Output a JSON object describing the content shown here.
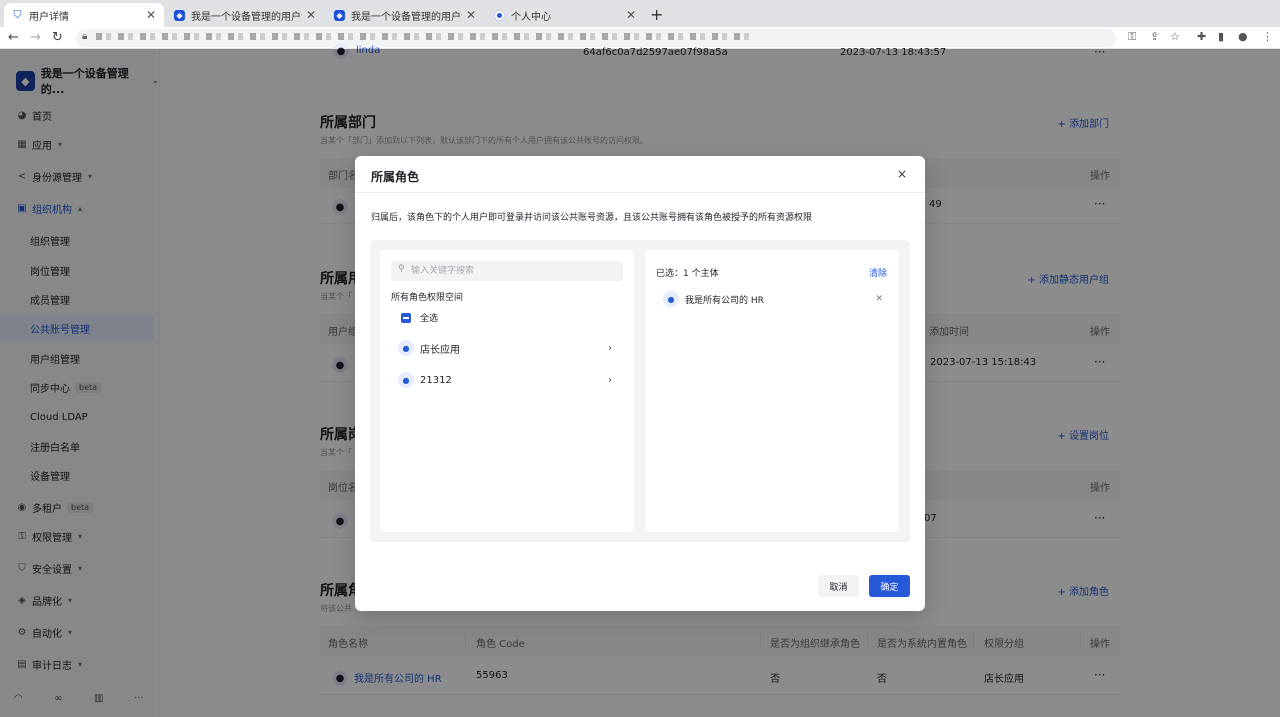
{
  "browser": {
    "tabs": [
      {
        "title": "用户详情",
        "active": true
      },
      {
        "title": "我是一个设备管理的用户池",
        "active": false
      },
      {
        "title": "我是一个设备管理的用户池",
        "active": false
      },
      {
        "title": "个人中心",
        "active": false
      }
    ]
  },
  "sidebar": {
    "brand": "我是一个设备管理的...",
    "items": [
      {
        "label": "首页"
      },
      {
        "label": "应用"
      },
      {
        "label": "身份源管理"
      },
      {
        "label": "组织机构"
      },
      {
        "label": "组织管理"
      },
      {
        "label": "岗位管理"
      },
      {
        "label": "成员管理"
      },
      {
        "label": "公共账号管理"
      },
      {
        "label": "用户组管理"
      },
      {
        "label": "同步中心",
        "badge": "beta"
      },
      {
        "label": "Cloud LDAP"
      },
      {
        "label": "注册白名单"
      },
      {
        "label": "设备管理"
      },
      {
        "label": "多租户",
        "badge": "beta"
      },
      {
        "label": "权限管理"
      },
      {
        "label": "安全设置"
      },
      {
        "label": "品牌化"
      },
      {
        "label": "自动化"
      },
      {
        "label": "审计日志"
      }
    ]
  },
  "main": {
    "top_row": {
      "name": "linda",
      "id": "64af6c0a7d2597ae07f98a5a",
      "time": "2023-07-13 18:43:57"
    },
    "departments": {
      "title": "所属部门",
      "desc": "当某个「部门」添加到以下列表，默认该部门下的所有个人用户拥有该公共账号的访问权限。",
      "action": "+ 添加部门",
      "col_first": "部门名",
      "col_ops": "操作",
      "row_tail": "49"
    },
    "groups": {
      "title": "所属用",
      "desc": "当某个「",
      "action": "+ 添加静态用户组",
      "col_first": "用户组",
      "col_time": "添加时间",
      "col_ops": "操作",
      "row_time": "2023-07-13 15:18:43"
    },
    "posts": {
      "title": "所属岗",
      "desc": "当某个「",
      "action": "+ 设置岗位",
      "col_first": "岗位名",
      "col_ops": "操作",
      "row_tail": "07"
    },
    "roles": {
      "title": "所属角",
      "desc": "将该公共",
      "action": "+ 添加角色",
      "columns": [
        "角色名称",
        "角色 Code",
        "是否为组织继承角色",
        "是否为系统内置角色",
        "权限分组",
        "操作"
      ],
      "row": {
        "name": "我是所有公司的 HR",
        "code": "55963",
        "inherit": "否",
        "builtin": "否",
        "group": "店长应用"
      }
    },
    "more": "···"
  },
  "modal": {
    "title": "所属角色",
    "desc": "归属后，该角色下的个人用户即可登录并访问该公共账号资源，且该公共账号拥有该角色被授予的所有资源权限",
    "search_placeholder": "输入关键字搜索",
    "space_label": "所有角色权限空间",
    "check_all": "全选",
    "apps": [
      {
        "label": "店长应用"
      },
      {
        "label": "21312"
      }
    ],
    "selected_count": "已选：1 个主体",
    "clear": "清除",
    "selected": [
      {
        "label": "我是所有公司的 HR"
      }
    ],
    "cancel": "取消",
    "ok": "确定",
    "close": "×"
  }
}
